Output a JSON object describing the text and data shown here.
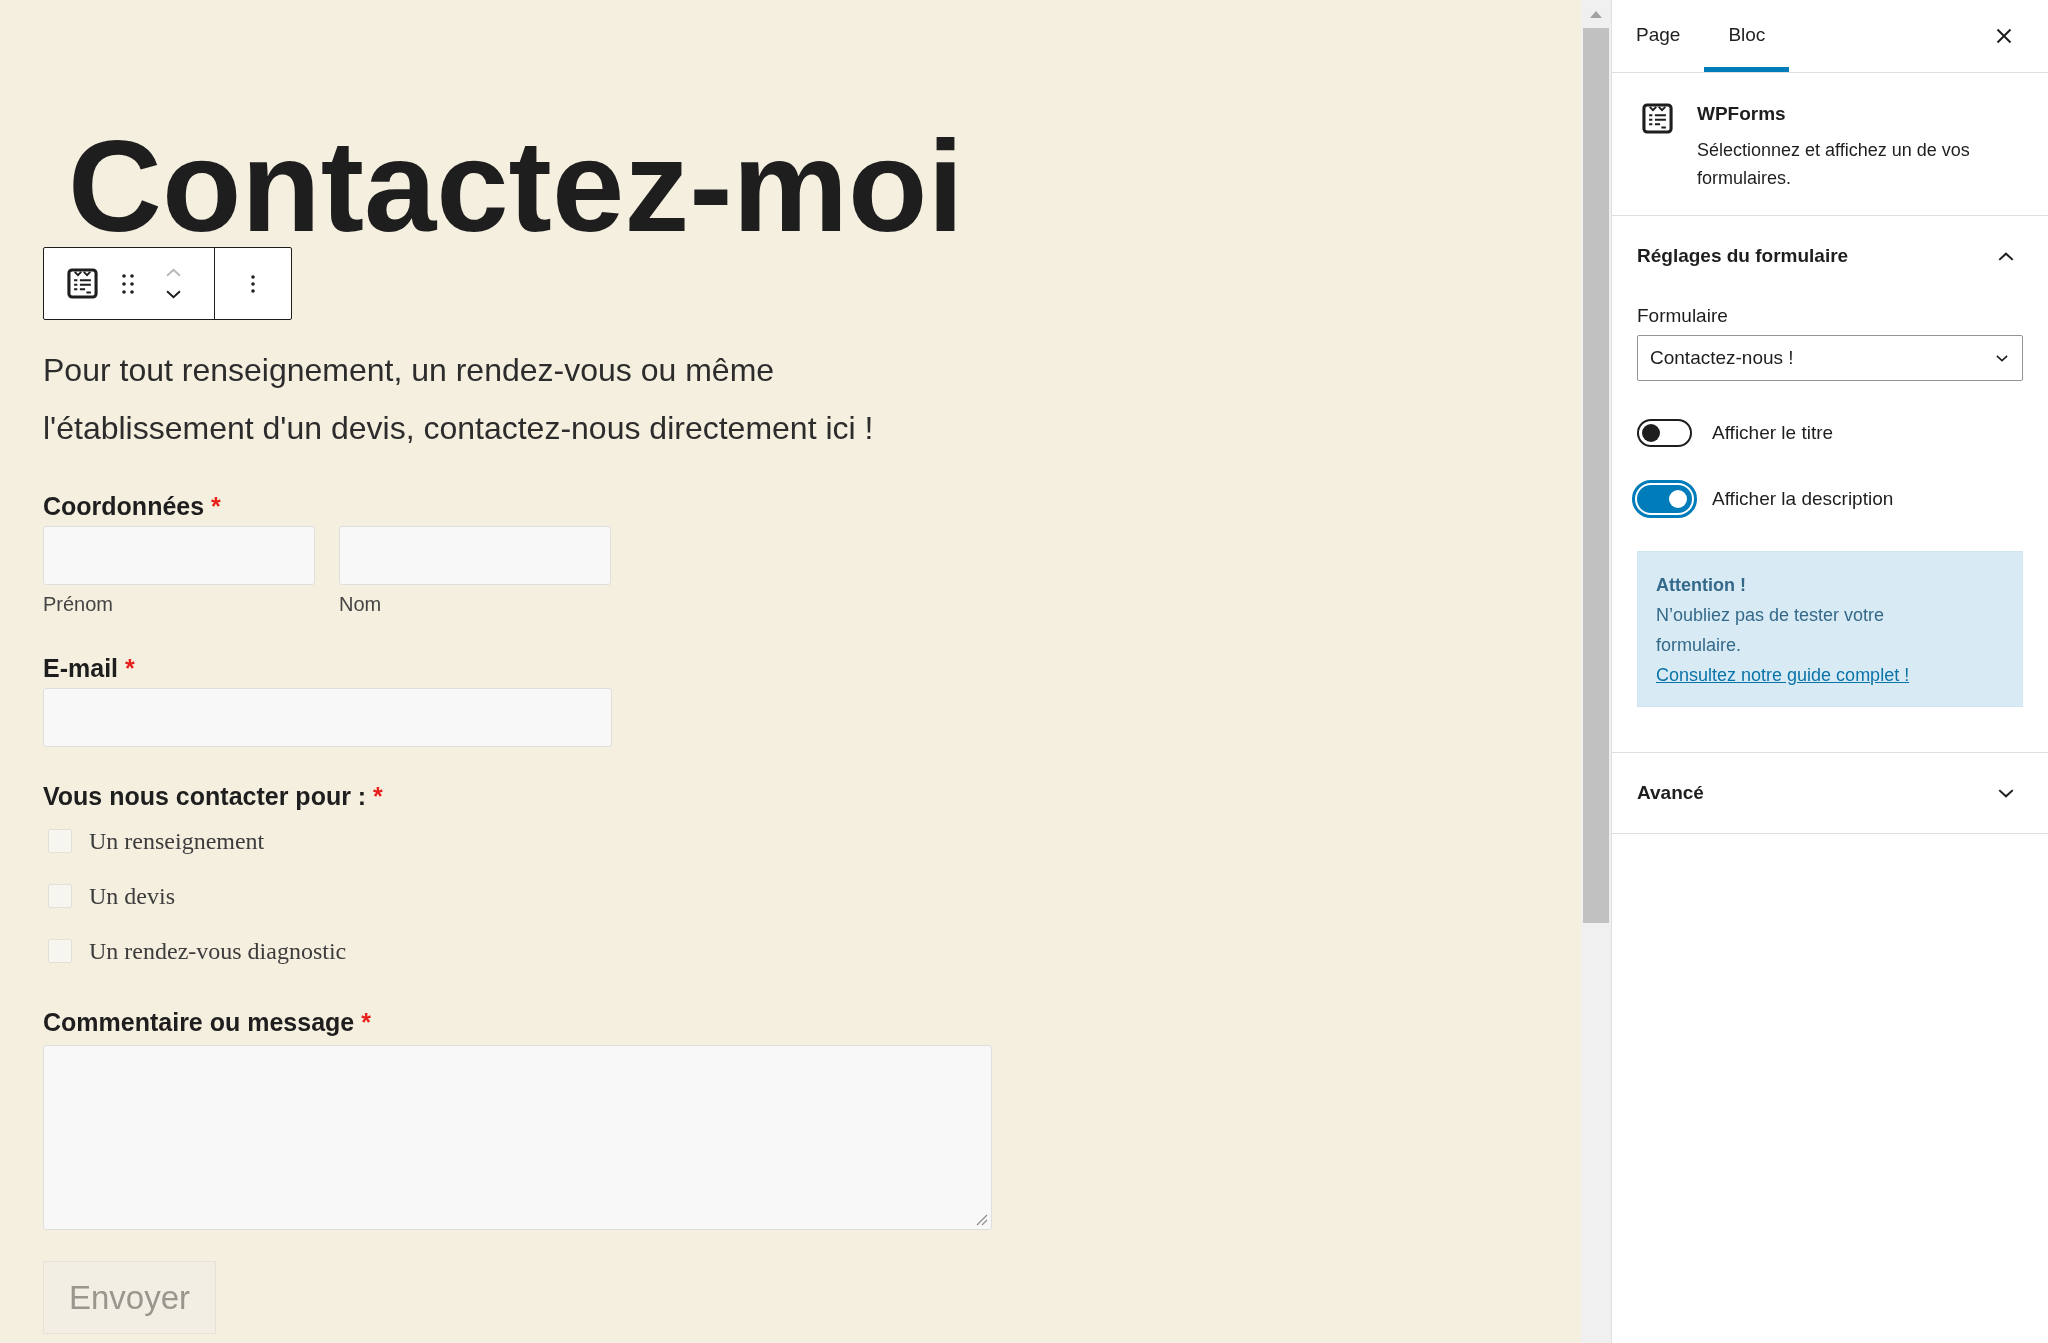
{
  "editor": {
    "heading": "Contactez-moi",
    "block_toolbar": {
      "move_up": {
        "disabled": true
      },
      "move_down": {
        "disabled": false
      }
    },
    "intro": "Pour tout renseignement, un rendez-vous ou même l'établissement d'un devis, contactez-nous directement ici !",
    "form": {
      "fields": [
        {
          "kind": "name",
          "label": "Coordonnées",
          "required_mark": "*",
          "sublabels": [
            "Prénom",
            "Nom"
          ]
        },
        {
          "kind": "email",
          "label": "E-mail",
          "required_mark": "*"
        },
        {
          "kind": "checkboxes",
          "label": "Vous nous contacter pour :",
          "required_mark": "*",
          "options": [
            {
              "label": "Un renseignement",
              "checked": false
            },
            {
              "label": "Un devis",
              "checked": false
            },
            {
              "label": "Un rendez-vous diagnostic",
              "checked": false
            }
          ]
        },
        {
          "kind": "textarea",
          "label": "Commentaire ou message",
          "required_mark": "*"
        }
      ],
      "submit": {
        "label": "Envoyer",
        "disabled": true
      }
    }
  },
  "sidebar": {
    "tabs": [
      {
        "label": "Page",
        "selected": false
      },
      {
        "label": "Bloc",
        "selected": true
      }
    ],
    "block_card": {
      "title": "WPForms",
      "description": "Sélectionnez et affichez un de vos formulaires."
    },
    "panels": [
      {
        "title": "Réglages du formulaire",
        "expanded": true,
        "controls": [
          {
            "kind": "select",
            "label": "Formulaire",
            "value": "Contactez-nous !"
          },
          {
            "kind": "toggle",
            "label": "Afficher le titre",
            "on": false,
            "focused": false
          },
          {
            "kind": "toggle",
            "label": "Afficher la description",
            "on": true,
            "focused": true
          }
        ],
        "notice": {
          "title": "Attention !",
          "text": "N’oubliez pas de tester votre formulaire.",
          "link": "Consultez notre guide complet !"
        }
      },
      {
        "title": "Avancé",
        "expanded": false
      }
    ]
  }
}
